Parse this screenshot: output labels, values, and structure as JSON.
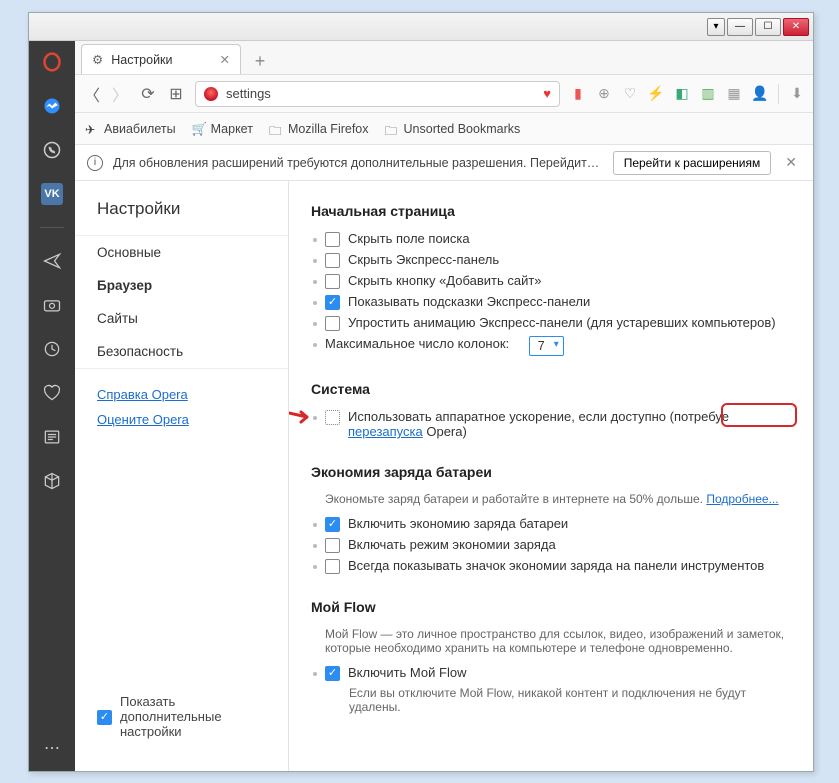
{
  "tab": {
    "title": "Настройки"
  },
  "url": {
    "text": "settings"
  },
  "bookmarks": [
    "Авиабилеты",
    "Маркет",
    "Mozilla Firefox",
    "Unsorted Bookmarks"
  ],
  "notice": {
    "text": "Для обновления расширений требуются дополнительные разрешения. Перейдите в ...",
    "button": "Перейти к расширениям"
  },
  "sidenav": {
    "title": "Настройки",
    "items": [
      "Основные",
      "Браузер",
      "Сайты",
      "Безопасность"
    ],
    "links": [
      "Справка Opera",
      "Оцените Opera"
    ],
    "advanced": "Показать дополнительные настройки"
  },
  "sections": {
    "home": {
      "title": "Начальная страница",
      "hide_search": "Скрыть поле поиска",
      "hide_speed": "Скрыть Экспресс-панель",
      "hide_add": "Скрыть кнопку «Добавить сайт»",
      "show_hints": "Показывать подсказки Экспресс-панели",
      "simplify": "Упростить анимацию Экспресс-панели (для устаревших компьютеров)",
      "max_cols_label": "Максимальное число колонок:",
      "max_cols_value": "7"
    },
    "system": {
      "title": "Система",
      "hw_pre": "Использовать аппаратное ускорение, если доступно (потребуе",
      "hw_link": "перезапуска",
      "hw_post": " Opera)"
    },
    "battery": {
      "title": "Экономия заряда батареи",
      "desc": "Экономьте заряд батареи и работайте в интернете на 50% дольше.",
      "more": "Подробнее...",
      "enable": "Включить экономию заряда батареи",
      "mode": "Включать режим экономии заряда",
      "icon": "Всегда показывать значок экономии заряда на панели инструментов"
    },
    "flow": {
      "title": "Мой Flow",
      "desc": "Мой Flow — это личное пространство для ссылок, видео, изображений и заметок, которые необходимо хранить на компьютере и телефоне одновременно.",
      "enable": "Включить Мой Flow",
      "note": "Если вы отключите Мой Flow, никакой контент и подключения не будут удалены."
    }
  }
}
